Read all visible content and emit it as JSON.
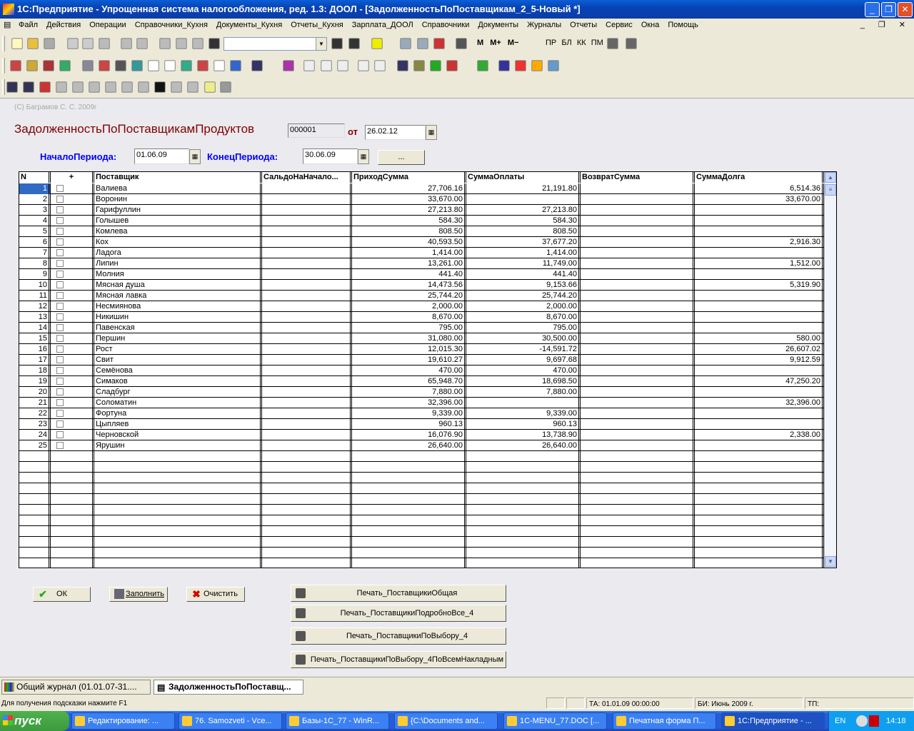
{
  "window": {
    "title": "1С:Предприятие - Упрощенная система налогообложения, ред. 1.3: ДООЛ - [ЗадолженностьПоПоставщикам_2_5-Новый *]",
    "minimize": "_",
    "restore": "❐",
    "close": "✕"
  },
  "menu": [
    "Файл",
    "Действия",
    "Операции",
    "Справочники_Кухня",
    "Документы_Кухня",
    "Отчеты_Кухня",
    "Зарплата_ДООЛ",
    "Справочники",
    "Документы",
    "Журналы",
    "Отчеты",
    "Сервис",
    "Окна",
    "Помощь"
  ],
  "toolbar_text": {
    "m": "М",
    "mplus": "М+",
    "mminus": "М−",
    "pr": "ПР",
    "bl": "БЛ",
    "kk": "КК",
    "pm": "ПМ"
  },
  "form": {
    "copyright": "(С) Баграмов С. С.  2009г",
    "title": "ЗадолженностьПоПоставщикамПродуктов",
    "doc_number": "000001",
    "from_label": "от",
    "doc_date": "26.02.12",
    "period_start_label": "НачалоПериода:",
    "period_start": "01.06.09",
    "period_end_label": "КонецПериода:",
    "period_end": "30.06.09",
    "ellipsis_button": "..."
  },
  "table": {
    "columns": [
      "N",
      "+",
      "Поставщик",
      "СальдоНаНачало...",
      "ПриходСумма",
      "СуммаОплаты",
      "ВозвратСумма",
      "СуммаДолга"
    ],
    "rows": [
      [
        "1",
        "",
        "Валиева",
        "",
        "27,706.16",
        "21,191.80",
        "",
        "6,514.36"
      ],
      [
        "2",
        "",
        "Воронин",
        "",
        "33,670.00",
        "",
        "",
        "33,670.00"
      ],
      [
        "3",
        "",
        "Гарифуллин",
        "",
        "27,213.80",
        "27,213.80",
        "",
        ""
      ],
      [
        "4",
        "",
        "Голышев",
        "",
        "584.30",
        "584.30",
        "",
        ""
      ],
      [
        "5",
        "",
        "Комлева",
        "",
        "808.50",
        "808.50",
        "",
        ""
      ],
      [
        "6",
        "",
        "Кох",
        "",
        "40,593.50",
        "37,677.20",
        "",
        "2,916.30"
      ],
      [
        "7",
        "",
        "Ладога",
        "",
        "1,414.00",
        "1,414.00",
        "",
        ""
      ],
      [
        "8",
        "",
        "Липин",
        "",
        "13,261.00",
        "11,749.00",
        "",
        "1,512.00"
      ],
      [
        "9",
        "",
        "Молния",
        "",
        "441.40",
        "441.40",
        "",
        ""
      ],
      [
        "10",
        "",
        "Мясная душа",
        "",
        "14,473.56",
        "9,153.66",
        "",
        "5,319.90"
      ],
      [
        "11",
        "",
        "Мясная лавка",
        "",
        "25,744.20",
        "25,744.20",
        "",
        ""
      ],
      [
        "12",
        "",
        "Несмиянова",
        "",
        "2,000.00",
        "2,000.00",
        "",
        ""
      ],
      [
        "13",
        "",
        "Никишин",
        "",
        "8,670.00",
        "8,670.00",
        "",
        ""
      ],
      [
        "14",
        "",
        "Павенская",
        "",
        "795.00",
        "795.00",
        "",
        ""
      ],
      [
        "15",
        "",
        "Першин",
        "",
        "31,080.00",
        "30,500.00",
        "",
        "580.00"
      ],
      [
        "16",
        "",
        "Рост",
        "",
        "12,015.30",
        "-14,591.72",
        "",
        "26,607.02"
      ],
      [
        "17",
        "",
        "Свит",
        "",
        "19,610.27",
        "9,697.68",
        "",
        "9,912.59"
      ],
      [
        "18",
        "",
        "Семёнова",
        "",
        "470.00",
        "470.00",
        "",
        ""
      ],
      [
        "19",
        "",
        "Симаков",
        "",
        "65,948.70",
        "18,698.50",
        "",
        "47,250.20"
      ],
      [
        "20",
        "",
        "Сладбург",
        "",
        "7,880.00",
        "7,880.00",
        "",
        ""
      ],
      [
        "21",
        "",
        "Соломатин",
        "",
        "32,396.00",
        "",
        "",
        "32,396.00"
      ],
      [
        "22",
        "",
        "Фортуна",
        "",
        "9,339.00",
        "9,339.00",
        "",
        ""
      ],
      [
        "23",
        "",
        "Цыпляев",
        "",
        "960.13",
        "960.13",
        "",
        ""
      ],
      [
        "24",
        "",
        "Черновской",
        "",
        "16,076.90",
        "13,738.90",
        "",
        "2,338.00"
      ],
      [
        "25",
        "",
        "Ярушин",
        "",
        "26,640.00",
        "26,640.00",
        "",
        ""
      ]
    ]
  },
  "buttons": {
    "ok": "ОК",
    "fill": "Заполнить",
    "clear": "Очистить",
    "print": [
      "Печать_ПоставщикиОбщая",
      "Печать_ПоставщикиПодробноВсе_4",
      "Печать_ПоставщикиПоВыбору_4",
      "Печать_ПоставщикиПоВыбору_4ПоВсемНакладным"
    ]
  },
  "mdi_tabs": [
    "Общий журнал (01.01.07-31....",
    "ЗадолженностьПоПоставщ..."
  ],
  "status": {
    "hint": "Для получения подсказки нажмите F1",
    "ta": "ТА: 01.01.09  00:00:00",
    "bi": "БИ: Июнь 2009 г.",
    "tp": "ТП:"
  },
  "taskbar": {
    "start": "пуск",
    "tasks": [
      "Редактирование: ...",
      "76. Samozveti - Vce...",
      "Базы-1С_77 - WinR...",
      "{C:\\Documents and...",
      "1C-MENU_77.DOC [...",
      "Печатная форма П...",
      "1С:Предприятие - ..."
    ],
    "lang": "EN",
    "clock": "14:18"
  },
  "colors": {
    "title_red": "#800000",
    "label_blue": "#0000ff",
    "selected_cell": "#316ac5"
  }
}
